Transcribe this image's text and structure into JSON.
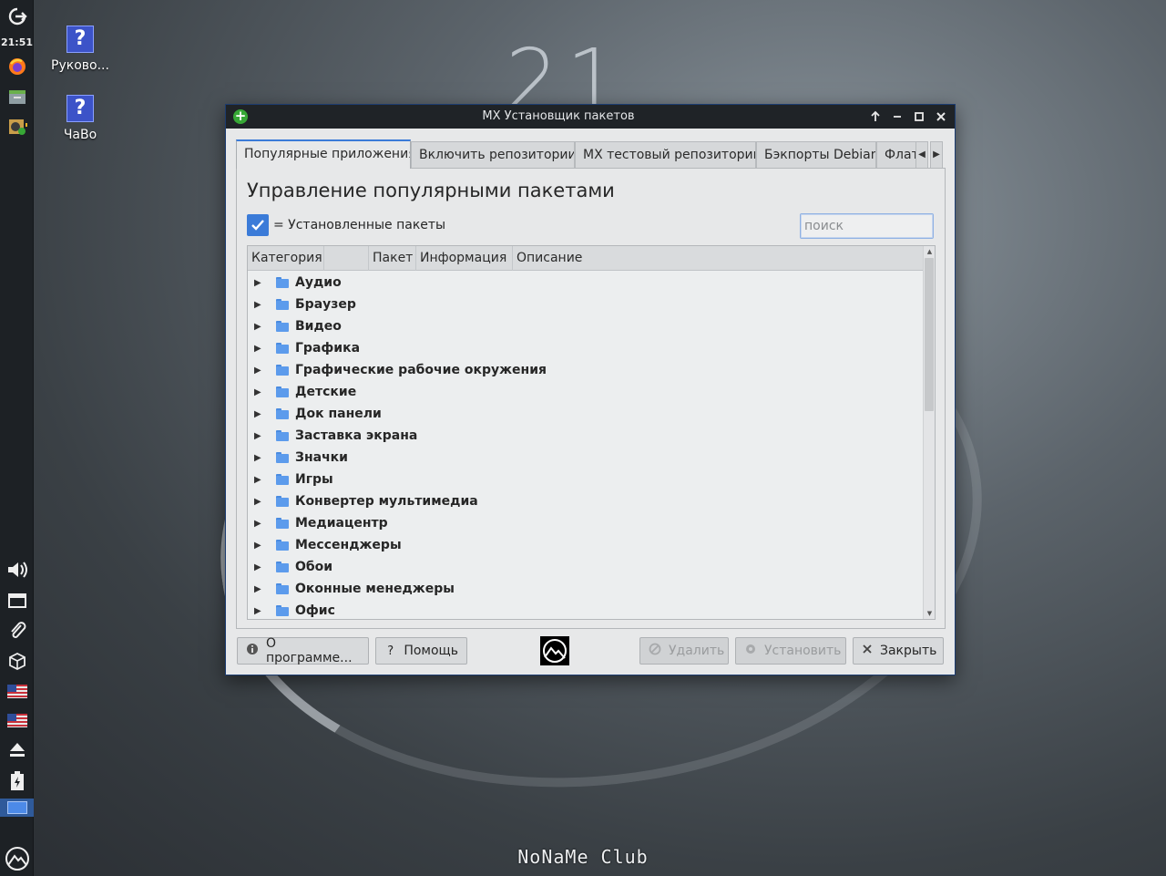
{
  "desktop": {
    "clock_big": "21",
    "watermark": "NoNaMe Club",
    "icons": [
      {
        "label": "Руково..."
      },
      {
        "label": "ЧаВо"
      }
    ]
  },
  "panel": {
    "time": "21:51",
    "launchers": [
      "logout-icon",
      "firefox-icon",
      "file-manager-icon",
      "package-installer-icon"
    ],
    "tray": [
      "volume-icon",
      "network-icon",
      "clipboard-icon",
      "updater-icon",
      "us-flag-icon",
      "us-flag-icon",
      "eject-icon",
      "battery-icon",
      "workspace-pager",
      "mx-menu-icon"
    ]
  },
  "window": {
    "title": "MX Установщик пакетов",
    "tabs": [
      {
        "label": "Популярные приложения",
        "active": true
      },
      {
        "label": "Включить репозитории"
      },
      {
        "label": "MX тестовый репозиторий"
      },
      {
        "label": "Бэкпорты Debian"
      },
      {
        "label": "Флатпаки"
      }
    ],
    "heading": "Управление популярными пакетами",
    "legend_text": "= Установленные пакеты",
    "search_placeholder": "поиск",
    "columns": [
      "Категория",
      "",
      "Пакет",
      "Информация",
      "Описание"
    ],
    "categories": [
      "Аудио",
      "Браузер",
      "Видео",
      "Графика",
      "Графические рабочие окружения",
      "Детские",
      "Док панели",
      "Заставка экрана",
      "Значки",
      "Игры",
      "Конвертер мультимедиа",
      "Медиацентр",
      "Мессенджеры",
      "Обои",
      "Оконные менеджеры",
      "Офис"
    ],
    "buttons": {
      "about": "О программе...",
      "help": "Помощь",
      "remove": "Удалить",
      "install": "Установить",
      "close": "Закрыть"
    },
    "accent_color": "#3b7bd8"
  }
}
